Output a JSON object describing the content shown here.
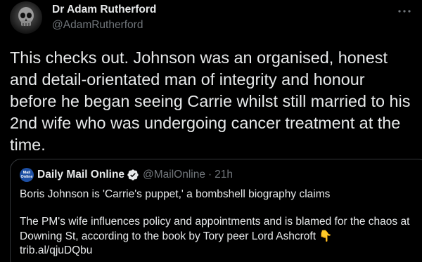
{
  "tweet": {
    "author": {
      "name": "Dr Adam Rutherford",
      "handle": "@AdamRutherford",
      "avatar_icon": "skull-avatar"
    },
    "more_icon": "more-horizontal-icon",
    "text": "This checks out. Johnson was an organised, honest and detail-orientated man of integrity and honour before he began seeing Carrie whilst still married to his 2nd wife who was undergoing cancer treatment at the time."
  },
  "quote": {
    "avatar_line1": "Mail",
    "avatar_line2": "Online",
    "author_name": "Daily Mail Online",
    "verified_icon": "verified-badge-icon",
    "handle": "@MailOnline",
    "separator": "·",
    "time": "21h",
    "headline": "Boris Johnson is 'Carrie's puppet,' a bombshell biography claims",
    "body": "The PM's wife influences policy and appointments and is blamed for the chaos at Downing St, according to the book by Tory peer Lord Ashcroft",
    "emoji": "👇",
    "link": "trib.al/qjuDQbu"
  },
  "colors": {
    "background": "#000000",
    "text": "#e7e9ea",
    "secondary": "#71767b",
    "border": "#333639",
    "verified": "#8b98a5",
    "mail_blue": "#1d4fa3"
  }
}
